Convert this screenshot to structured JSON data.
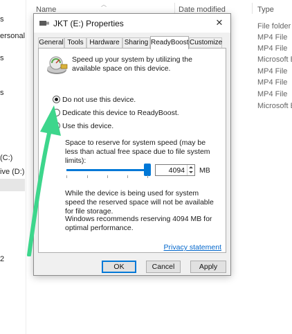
{
  "explorer": {
    "left_items": [
      "s",
      "ersonal",
      "s",
      "s",
      "(C:)",
      "ive (D:) N",
      "",
      "2"
    ],
    "columns": {
      "name": "Name",
      "date_modified": "Date modified",
      "type": "Type"
    },
    "types": [
      "File folder",
      "MP4 File",
      "MP4 File",
      "Microsoft Ec",
      "MP4 File",
      "MP4 File",
      "MP4 File",
      "Microsoft Ec"
    ]
  },
  "dialog": {
    "title": "JKT (E:) Properties",
    "close_glyph": "✕",
    "tabs": [
      "General",
      "Tools",
      "Hardware",
      "Sharing",
      "ReadyBoost",
      "Customize"
    ],
    "active_tab": "ReadyBoost",
    "intro": "Speed up your system by utilizing the available space on this device.",
    "options": [
      {
        "label": "Do not use this device.",
        "selected": true
      },
      {
        "label": "Dedicate this device to ReadyBoost.",
        "selected": false
      },
      {
        "label": "Use this device.",
        "selected": false
      }
    ],
    "reserve_label": "Space to reserve for system speed (may be less than actual free space due to file system limits):",
    "slider_level": 1.0,
    "reserve_value": "4094",
    "unit": "MB",
    "storage_note": "While the device is being used for system speed the reserved space will not be available for file storage.",
    "recommendation": "Windows recommends reserving 4094 MB for optimal performance.",
    "privacy_link": "Privacy statement",
    "buttons": {
      "ok": "OK",
      "cancel": "Cancel",
      "apply": "Apply"
    }
  },
  "annotation": {
    "arrow_color": "#3dd68c",
    "icon": "arrow-up-icon"
  }
}
